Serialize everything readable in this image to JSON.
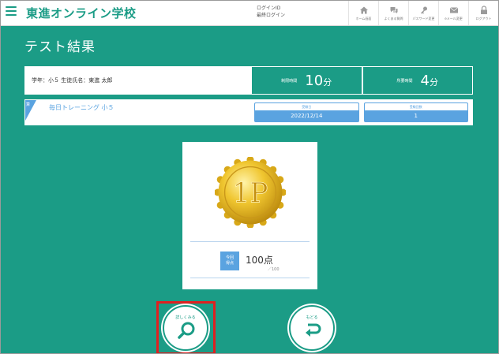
{
  "header": {
    "logo": "東進オンライン学校",
    "login_id_label": "ログインID",
    "login_last_label": "最終ログイン",
    "icons": [
      {
        "name": "home-icon",
        "label": "ホーム画面"
      },
      {
        "name": "faq-icon",
        "label": "よくある質問"
      },
      {
        "name": "key-icon",
        "label": "パスワード変更"
      },
      {
        "name": "mail-icon",
        "label": "eメール変更"
      },
      {
        "name": "lock-icon",
        "label": "ログアウト"
      }
    ]
  },
  "page": {
    "title": "テスト結果"
  },
  "student": {
    "info": "学年：小５  生徒氏名：東進 太郎",
    "limit_time_label": "制限時間",
    "limit_time_value": "10",
    "limit_time_unit": "分",
    "used_time_label": "所要時間",
    "used_time_value": "4",
    "used_time_unit": "分"
  },
  "test": {
    "badge": "算",
    "name": "毎日トレーニング 小５",
    "date_label": "受験日",
    "date_value": "2022/12/14",
    "count_label": "受験回数",
    "count_value": "1"
  },
  "result": {
    "medal_text": "1P",
    "score_badge_line1": "今回",
    "score_badge_line2": "得点",
    "score": "100点",
    "score_max": "／100"
  },
  "actions": {
    "detail_label": "詳しくみる",
    "back_label": "もどる"
  },
  "colors": {
    "primary": "#1b9c86",
    "accent_blue": "#5aa3e0",
    "highlight_red": "#e02020",
    "gold": "#e2b21d"
  }
}
